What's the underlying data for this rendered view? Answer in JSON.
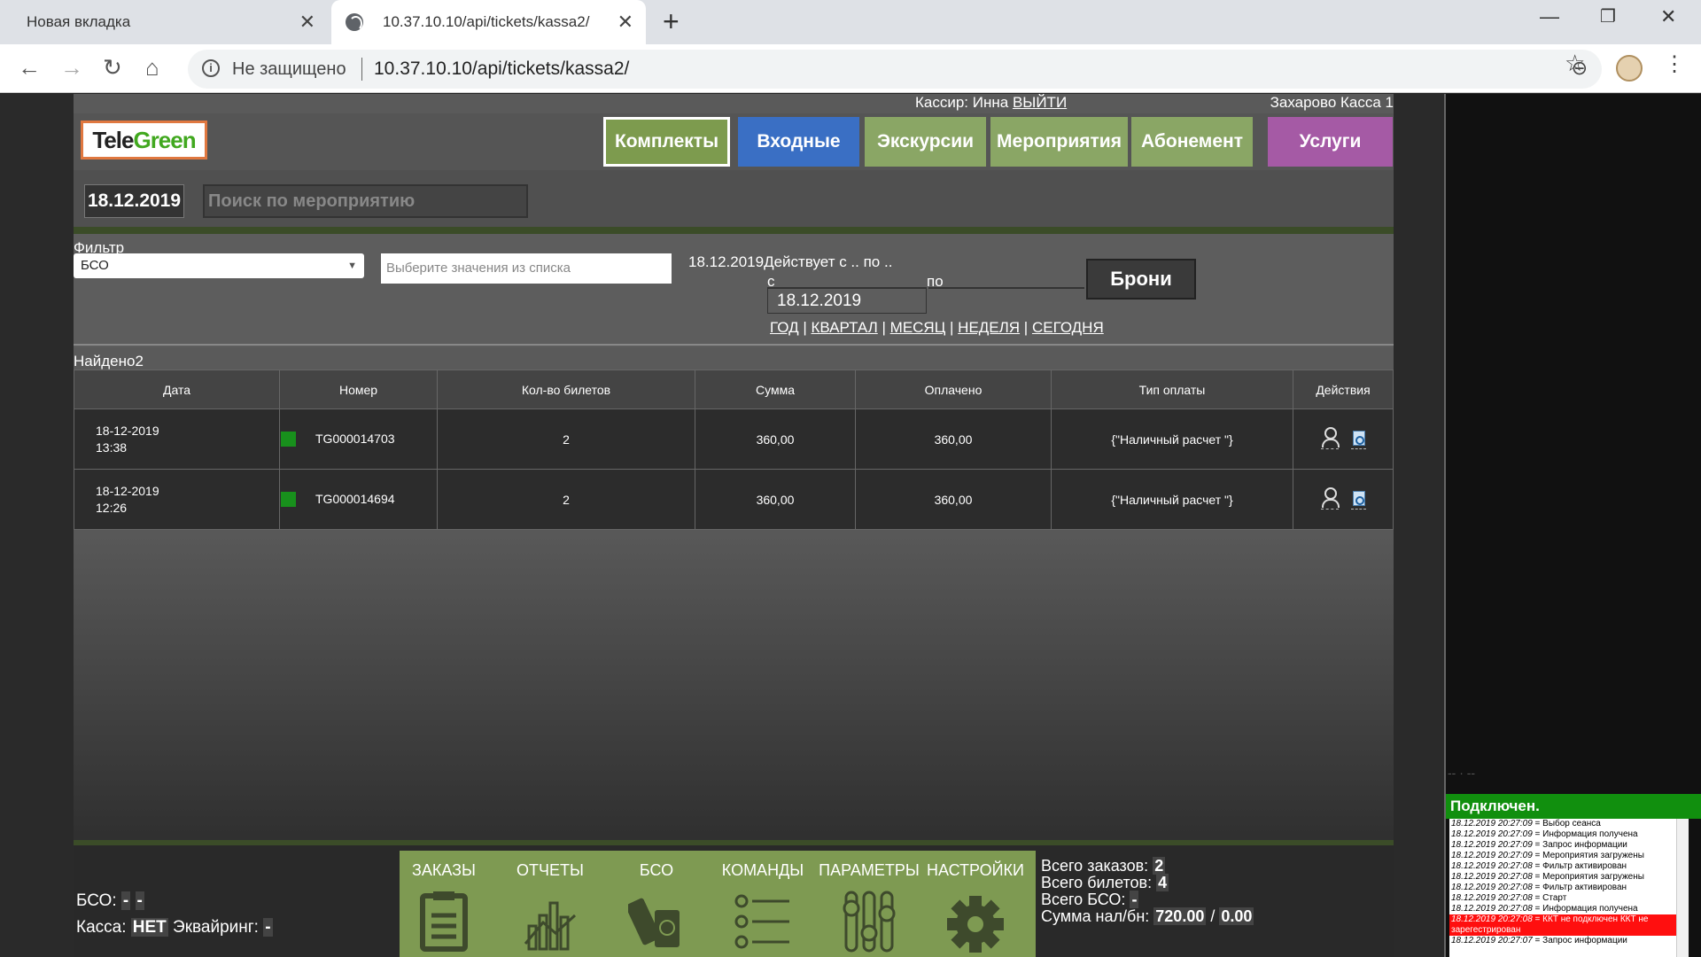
{
  "browser": {
    "tab1_title": "Новая вкладка",
    "tab2_title": "10.37.10.10/api/tickets/kassa2/",
    "not_secure": "Не защищено",
    "url": "10.37.10.10/api/tickets/kassa2/"
  },
  "header": {
    "cashier_label": "Кассир: Инна",
    "logout": "ВЫЙТИ",
    "location": "Захарово Касса 1",
    "logo_part1": "Tele",
    "logo_part2": "Green",
    "nav": [
      {
        "label": "Комплекты",
        "color": "#7d9b4e",
        "active": true
      },
      {
        "label": "Входные",
        "color": "#3a6fc4"
      },
      {
        "label": "Экскурсии",
        "color": "#8aa665"
      },
      {
        "label": "Мероприятия",
        "color": "#8aa665"
      },
      {
        "label": "Абонемент",
        "color": "#8aa665"
      },
      {
        "label": "Услуги",
        "color": "#a55aa5"
      }
    ]
  },
  "toolbar": {
    "date": "18.12.2019",
    "search_placeholder": "Поиск по мероприятию"
  },
  "filter": {
    "label": "Фильтр",
    "select_value": "БСО",
    "multi_placeholder": "Выберите значения из списка",
    "date_text": "18.12.2019Действует с .. по ..",
    "from_label": "с",
    "to_label": "по",
    "from_value": "18.12.2019",
    "periods": [
      "ГОД",
      "КВАРТАЛ",
      "МЕСЯЦ",
      "НЕДЕЛЯ",
      "СЕГОДНЯ"
    ],
    "broni_label": "Брони"
  },
  "found_text": "Найдено2",
  "table": {
    "headers": [
      "Дата",
      "Номер",
      "Кол-во билетов",
      "Сумма",
      "Оплачено",
      "Тип оплаты",
      "Действия"
    ],
    "rows": [
      {
        "date": "18-12-2019",
        "time": "13:38",
        "number": "TG000014703",
        "count": "2",
        "sum": "360,00",
        "paid": "360,00",
        "pay_type": "{\"Наличный расчет \"}"
      },
      {
        "date": "18-12-2019",
        "time": "12:26",
        "number": "TG000014694",
        "count": "2",
        "sum": "360,00",
        "paid": "360,00",
        "pay_type": "{\"Наличный расчет \"}"
      }
    ]
  },
  "footer": {
    "bso_label": "БСО:",
    "bso_val1": "-",
    "bso_val2": "-",
    "kassa_label": "Касса:",
    "kassa_val": "НЕТ",
    "acq_label": "Эквайринг:",
    "acq_val": "-",
    "menu": [
      {
        "label": "ЗАКАЗЫ",
        "icon": "clipboard-icon"
      },
      {
        "label": "ОТЧЕТЫ",
        "icon": "chart-icon"
      },
      {
        "label": "БСО",
        "icon": "tickets-icon"
      },
      {
        "label": "КОМАНДЫ",
        "icon": "list-icon"
      },
      {
        "label": "ПАРАМЕТРЫ",
        "icon": "sliders-icon"
      },
      {
        "label": "НАСТРОЙКИ",
        "icon": "gear-icon"
      }
    ],
    "total_orders_label": "Всего заказов:",
    "total_orders": "2",
    "total_tickets_label": "Всего билетов:",
    "total_tickets": "4",
    "total_bso_label": "Всего БСО:",
    "total_bso": "-",
    "sum_label": "Сумма нал/бн:",
    "sum_cash": "720.00",
    "sum_sep": "/",
    "sum_card": "0.00"
  },
  "side": {
    "status": "Подключен.",
    "log": [
      {
        "ts": "18.12.2019 20:27:09",
        "msg": "Выбор сеанса"
      },
      {
        "ts": "18.12.2019 20:27:09",
        "msg": "Информация получена"
      },
      {
        "ts": "18.12.2019 20:27:09",
        "msg": "Запрос информации"
      },
      {
        "ts": "18.12.2019 20:27:09",
        "msg": "Мероприятия загружены"
      },
      {
        "ts": "18.12.2019 20:27:08",
        "msg": "Фильтр активирован"
      },
      {
        "ts": "18.12.2019 20:27:08",
        "msg": "Мероприятия загружены"
      },
      {
        "ts": "18.12.2019 20:27:08",
        "msg": "Фильтр активирован"
      },
      {
        "ts": "18.12.2019 20:27:08",
        "msg": "Старт"
      },
      {
        "ts": "18.12.2019 20:27:08",
        "msg": "Информация получена"
      },
      {
        "ts": "18.12.2019 20:27:08",
        "msg": "ККТ не подключен ККТ не зарегестрирован",
        "error": true
      },
      {
        "ts": "18.12.2019 20:27:07",
        "msg": "Запрос информации"
      }
    ]
  }
}
